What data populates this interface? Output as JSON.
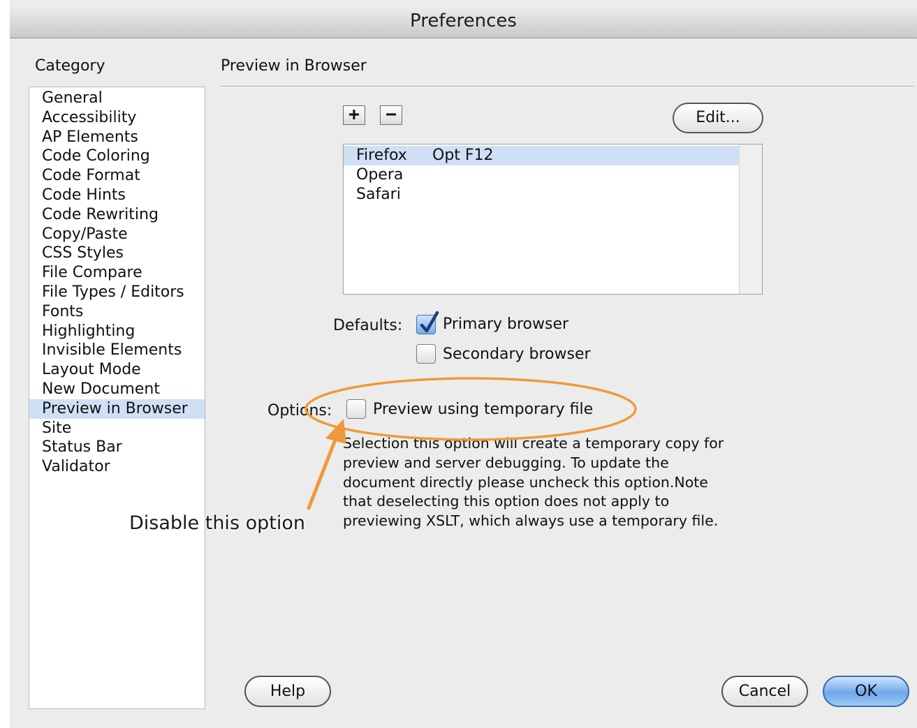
{
  "window": {
    "title": "Preferences"
  },
  "category": {
    "heading": "Category",
    "items": [
      "General",
      "Accessibility",
      "AP Elements",
      "Code Coloring",
      "Code Format",
      "Code Hints",
      "Code Rewriting",
      "Copy/Paste",
      "CSS Styles",
      "File Compare",
      "File Types / Editors",
      "Fonts",
      "Highlighting",
      "Invisible Elements",
      "Layout Mode",
      "New Document",
      "Preview in Browser",
      "Site",
      "Status Bar",
      "Validator"
    ],
    "selected": "Preview in Browser"
  },
  "section": {
    "heading": "Preview in Browser",
    "add_symbol": "+",
    "remove_symbol": "−",
    "edit_label": "Edit...",
    "browsers": [
      {
        "name": "Firefox",
        "shortcut": "Opt F12",
        "selected": true
      },
      {
        "name": "Opera",
        "shortcut": "",
        "selected": false
      },
      {
        "name": "Safari",
        "shortcut": "",
        "selected": false
      }
    ],
    "defaults_label": "Defaults:",
    "primary_label": "Primary browser",
    "primary_checked": true,
    "secondary_label": "Secondary browser",
    "secondary_checked": false,
    "options_label": "Options:",
    "temp_file_label": "Preview using temporary file",
    "temp_file_checked": false,
    "description_lines": [
      "Selection this option will create a temporary copy for",
      "preview and server debugging. To update the",
      "document directly please uncheck this option.Note",
      "that deselecting this option does not apply to",
      "previewing XSLT, which always use a temporary file."
    ]
  },
  "annotation": {
    "callout": "Disable this option",
    "color": "#f0993a"
  },
  "buttons": {
    "help": "Help",
    "cancel": "Cancel",
    "ok": "OK"
  },
  "colors": {
    "selection": "#cfe0f5",
    "window_bg": "#ececec",
    "default_button": "#6ea8ea"
  }
}
